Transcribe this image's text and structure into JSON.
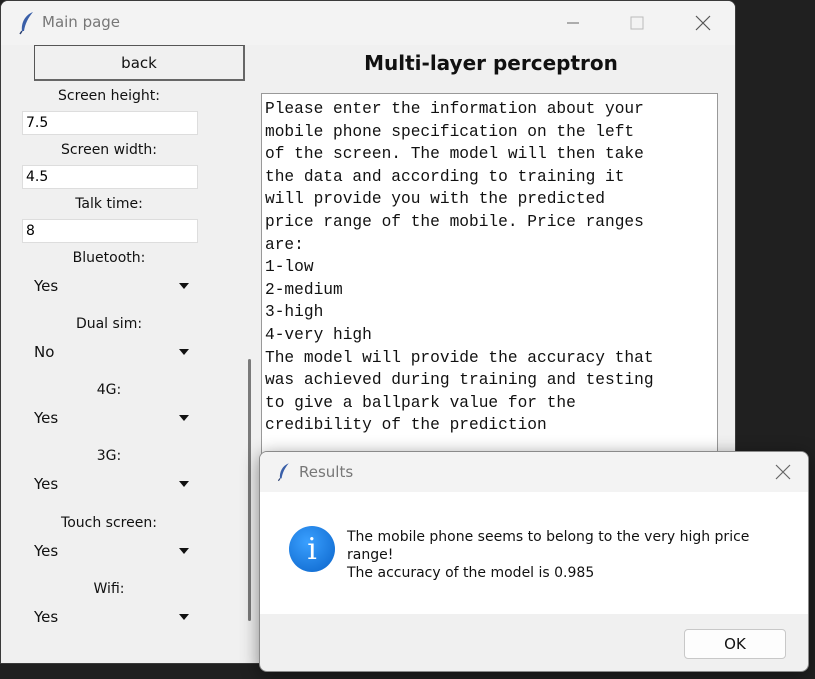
{
  "window": {
    "title": "Main page",
    "controls": {
      "minimize": "minimize-icon",
      "maximize": "maximize-icon",
      "close": "close-icon"
    }
  },
  "left_panel": {
    "back_label": "back",
    "fields": [
      {
        "label": "Screen height:",
        "value": "7.5"
      },
      {
        "label": "Screen width:",
        "value": "4.5"
      },
      {
        "label": "Talk time:",
        "value": "8"
      }
    ],
    "dropdowns": [
      {
        "label": "Bluetooth:",
        "value": "Yes"
      },
      {
        "label": "Dual sim:",
        "value": "No"
      },
      {
        "label": "4G:",
        "value": "Yes"
      },
      {
        "label": "3G:",
        "value": "Yes"
      },
      {
        "label": "Touch screen:",
        "value": "Yes"
      },
      {
        "label": "Wifi:",
        "value": "Yes"
      }
    ]
  },
  "main": {
    "heading": "Multi-layer perceptron",
    "instructions": "Please enter the information about your\nmobile phone specification on the left\nof the screen. The model will then take\nthe data and according to training it\nwill provide you with the predicted\nprice range of the mobile. Price ranges\nare:\n1-low\n2-medium\n3-high\n4-very high\nThe model will provide the accuracy that\nwas achieved during training and testing\nto give a ballpark value for the\ncredibility of the prediction"
  },
  "dialog": {
    "title": "Results",
    "icon": "info-icon",
    "message_line1": "The mobile phone seems to belong to the very high price range!",
    "message_line2": "The accuracy of the model is 0.985",
    "ok_label": "OK"
  }
}
